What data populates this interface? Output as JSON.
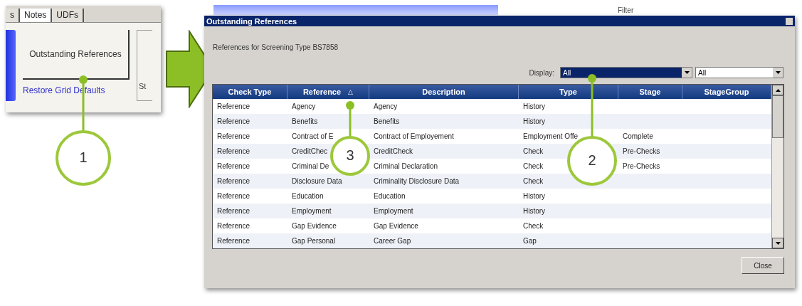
{
  "left_panel": {
    "tabs": [
      {
        "label": "s",
        "selected": false
      },
      {
        "label": "Notes",
        "selected": true
      },
      {
        "label": "UDFs",
        "selected": false
      }
    ],
    "button": "Outstanding References",
    "link": "Restore Grid Defaults",
    "group_label": "St"
  },
  "background_app": {
    "filter_label": "Filter"
  },
  "dialog": {
    "title": "Outstanding References",
    "subtitle": "References for Screening Type BS7858",
    "display_label": "Display:",
    "display_value": "All",
    "second_value": "All",
    "table": {
      "columns": [
        {
          "label": "Check Type"
        },
        {
          "label": "Reference",
          "sort": "△"
        },
        {
          "label": "Description"
        },
        {
          "label": "Type"
        },
        {
          "label": "Stage"
        },
        {
          "label": "StageGroup"
        }
      ],
      "rows": [
        {
          "check_type": "Reference",
          "reference": "Agency",
          "description": "Agency",
          "type": "History"
        },
        {
          "check_type": "Reference",
          "reference": "Benefits",
          "description": "Benefits",
          "type": "History"
        },
        {
          "check_type": "Reference",
          "reference": "Contract of E",
          "description": "Contract of Employement",
          "type": "Employment Offe",
          "stage": "Complete"
        },
        {
          "check_type": "Reference",
          "reference": "CreditChec",
          "description": "CreditCheck",
          "type": "Check",
          "stage": "Pre-Checks"
        },
        {
          "check_type": "Reference",
          "reference": "Criminal De",
          "description": "Criminal Declaration",
          "type": "Check",
          "stage": "Pre-Checks"
        },
        {
          "check_type": "Reference",
          "reference": "Disclosure Data",
          "description": "Criminality Disclosure Data",
          "type": "Check"
        },
        {
          "check_type": "Reference",
          "reference": "Education",
          "description": "Education",
          "type": "History"
        },
        {
          "check_type": "Reference",
          "reference": "Employment",
          "description": "Employment",
          "type": "History"
        },
        {
          "check_type": "Reference",
          "reference": "Gap Evidence",
          "description": "Gap Evidence",
          "type": "Check"
        },
        {
          "check_type": "Reference",
          "reference": "Gap Personal",
          "description": "Career Gap",
          "type": "Gap"
        }
      ]
    },
    "close": "Close"
  },
  "callouts": [
    {
      "number": "1"
    },
    {
      "number": "3"
    },
    {
      "number": "2"
    }
  ]
}
